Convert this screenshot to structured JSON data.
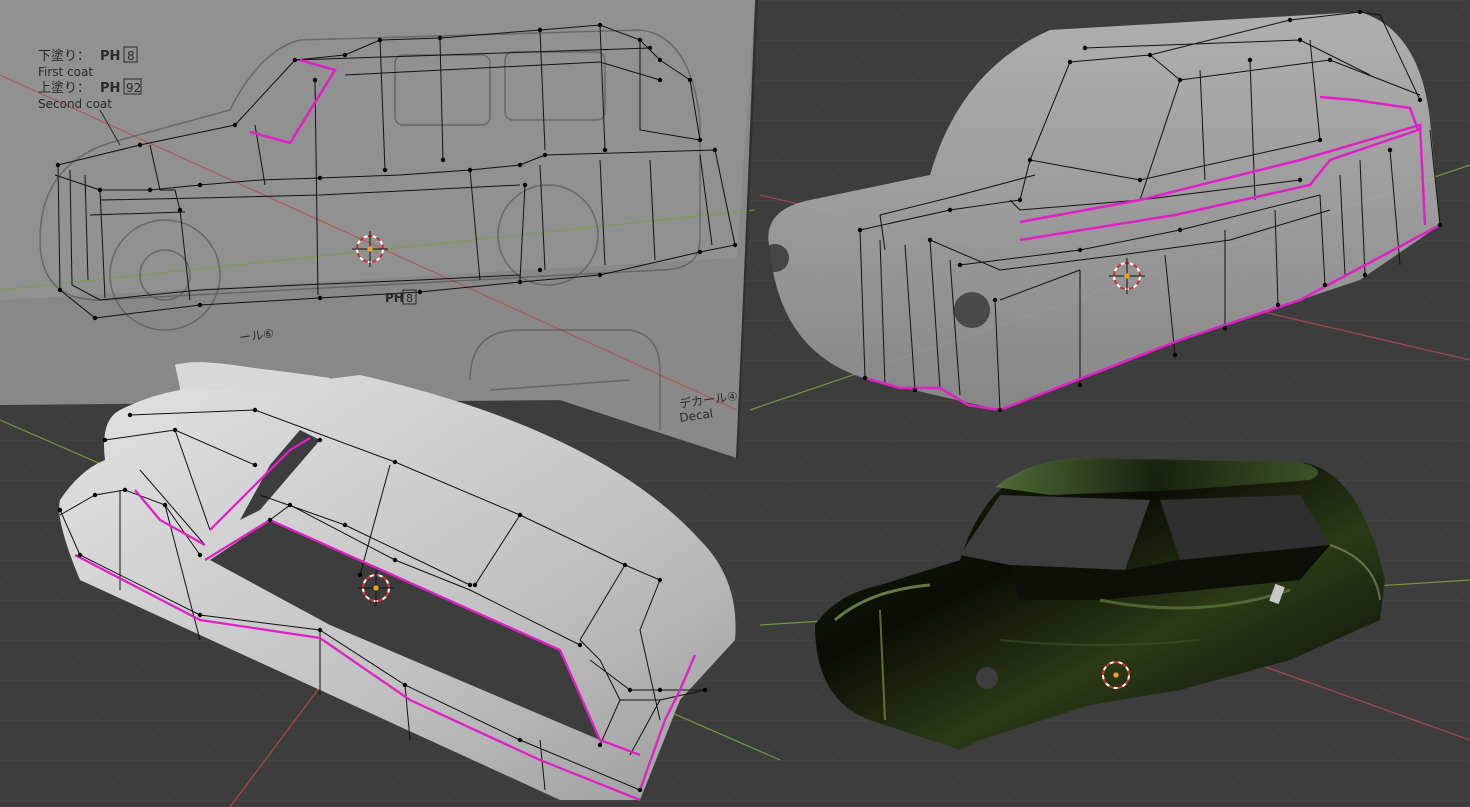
{
  "reference": {
    "first_coat_jp": "下塗り：",
    "first_coat_code": "PH",
    "first_coat_num": "8",
    "first_coat_en": "First coat",
    "second_coat_jp": "上塗り：",
    "second_coat_code": "PH",
    "second_coat_num": "92",
    "second_coat_en": "Second coat",
    "side_code": "PH",
    "side_num": "8",
    "decal_top": "ール⑥",
    "decal_jp": "デカール④",
    "decal_en": "Decal"
  },
  "colors": {
    "background": "#3d3d3d",
    "grid": "#4a4a4a",
    "x_axis": "#a8484e",
    "y_axis": "#6e9a3a",
    "edge_selected": "#e020c8",
    "mesh_wire": "#111111",
    "mesh_vertex": "#000000",
    "cursor_red": "#d03030",
    "cursor_dot": "#f0a020"
  },
  "viewports": [
    {
      "name": "viewport-top-left",
      "mode": "wireframe-over-reference"
    },
    {
      "name": "viewport-top-right",
      "mode": "xray-mesh"
    },
    {
      "name": "viewport-bottom-left",
      "mode": "solid-mesh"
    },
    {
      "name": "viewport-bottom-right",
      "mode": "material-preview"
    }
  ]
}
